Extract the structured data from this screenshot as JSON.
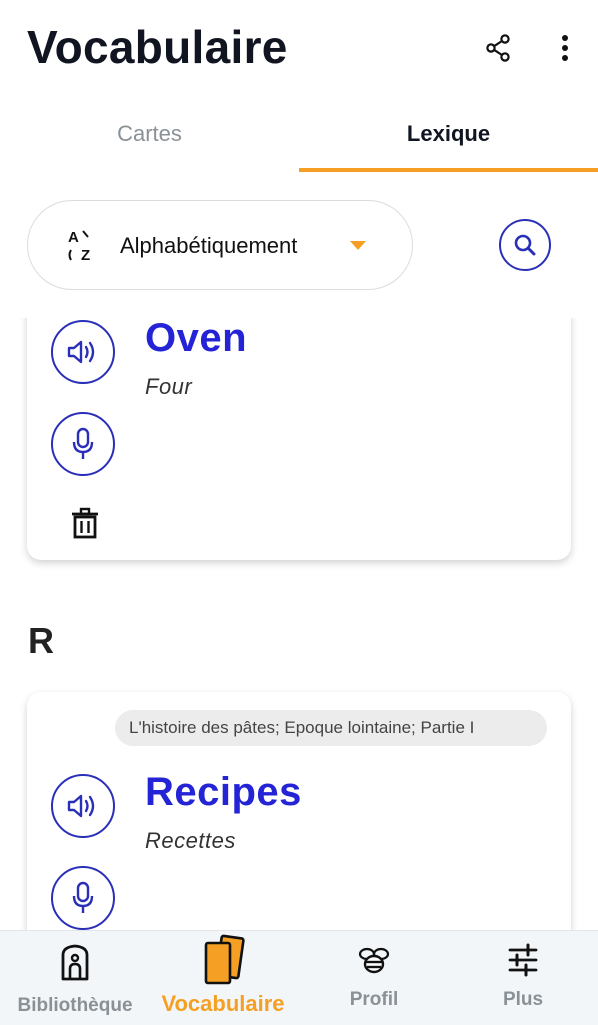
{
  "header": {
    "title": "Vocabulaire"
  },
  "tabs": [
    {
      "label": "Cartes",
      "active": false
    },
    {
      "label": "Lexique",
      "active": true
    }
  ],
  "sort": {
    "label": "Alphabétiquement"
  },
  "sections": [
    {
      "letter": "",
      "entries": [
        {
          "term": "Oven",
          "translation": "Four"
        }
      ]
    },
    {
      "letter": "R",
      "entries": [
        {
          "source": "L'histoire des pâtes; Epoque lointaine; Partie I",
          "term": "Recipes",
          "translation": "Recettes"
        }
      ]
    }
  ],
  "bottom_nav": [
    {
      "label": "Bibliothèque",
      "icon": "library-icon",
      "active": false
    },
    {
      "label": "Vocabulaire",
      "icon": "vocabulary-cards-icon",
      "active": true
    },
    {
      "label": "Profil",
      "icon": "bee-icon",
      "active": false
    },
    {
      "label": "Plus",
      "icon": "sliders-icon",
      "active": false
    }
  ],
  "colors": {
    "accent": "#f5a024",
    "primary_blue": "#2424d6",
    "icon_blue": "#2a2fb8",
    "inactive_gray": "#8a9196"
  }
}
